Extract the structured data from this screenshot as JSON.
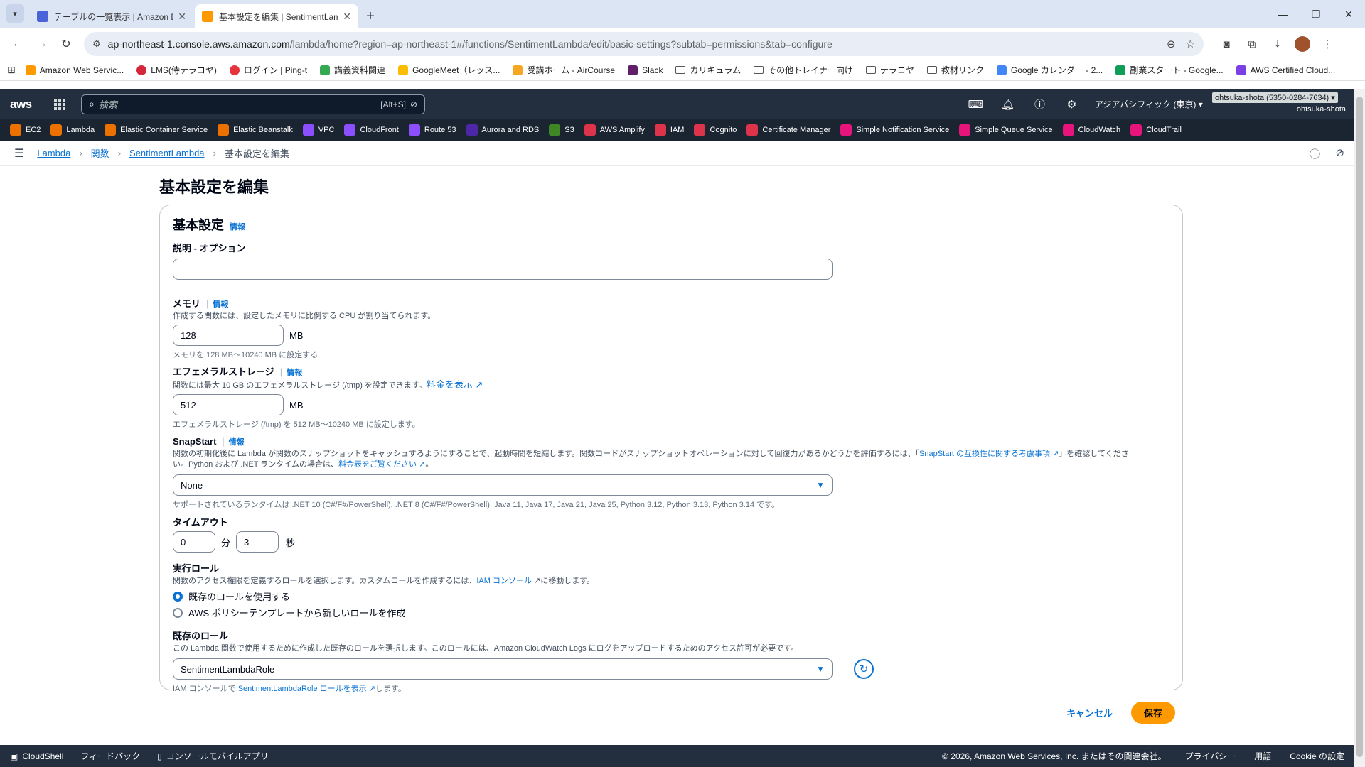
{
  "browser": {
    "tabs": [
      {
        "title": "テーブルの一覧表示 | Amazon Dy",
        "active": false,
        "color": "#4a63d9"
      },
      {
        "title": "基本設定を編集 | SentimentLam",
        "active": true,
        "color": "#ff9900"
      }
    ],
    "url_host": "ap-northeast-1.console.aws.amazon.com",
    "url_path": "/lambda/home?region=ap-northeast-1#/functions/SentimentLambda/edit/basic-settings?subtab=permissions&tab=configure",
    "bookmarks": [
      {
        "label": "Amazon Web Servic...",
        "color": "#ff9900"
      },
      {
        "label": "LMS(侍テラコヤ)",
        "color": "#d6263b"
      },
      {
        "label": "ログイン | Ping-t",
        "color": "#e6343d"
      },
      {
        "label": "講義資料関連",
        "color": "#34a853"
      },
      {
        "label": "GoogleMeet（レッス...",
        "color": "#fbbc05"
      },
      {
        "label": "受講ホーム - AirCourse",
        "color": "#f5a623"
      },
      {
        "label": "Slack",
        "color": "#611f69"
      },
      {
        "label": "カリキュラム",
        "folder": true
      },
      {
        "label": "その他トレイナー向け",
        "folder": true
      },
      {
        "label": "テラコヤ",
        "folder": true
      },
      {
        "label": "教材リンク",
        "folder": true
      },
      {
        "label": "Google カレンダー - 2...",
        "color": "#4285f4"
      },
      {
        "label": "副業スタート - Google...",
        "color": "#0f9d58"
      },
      {
        "label": "AWS Certified Cloud...",
        "color": "#7b3fe4"
      }
    ]
  },
  "aws": {
    "logo": "aws",
    "search_placeholder": "検索",
    "search_shortcut": "[Alt+S]",
    "region": "アジアパシフィック (東京) ▾",
    "account": "ohtsuka-shota (5350-0284-7634) ▾",
    "user": "ohtsuka-shota",
    "services": [
      {
        "label": "EC2",
        "color": "#ed7100"
      },
      {
        "label": "Lambda",
        "color": "#ed7100"
      },
      {
        "label": "Elastic Container Service",
        "color": "#ed7100"
      },
      {
        "label": "Elastic Beanstalk",
        "color": "#ed7100"
      },
      {
        "label": "VPC",
        "color": "#8c4fff"
      },
      {
        "label": "CloudFront",
        "color": "#8c4fff"
      },
      {
        "label": "Route 53",
        "color": "#8c4fff"
      },
      {
        "label": "Aurora and RDS",
        "color": "#4d27a8"
      },
      {
        "label": "S3",
        "color": "#3f8624"
      },
      {
        "label": "AWS Amplify",
        "color": "#dd344c"
      },
      {
        "label": "IAM",
        "color": "#dd344c"
      },
      {
        "label": "Cognito",
        "color": "#dd344c"
      },
      {
        "label": "Certificate Manager",
        "color": "#dd344c"
      },
      {
        "label": "Simple Notification Service",
        "color": "#e7157b"
      },
      {
        "label": "Simple Queue Service",
        "color": "#e7157b"
      },
      {
        "label": "CloudWatch",
        "color": "#e7157b"
      },
      {
        "label": "CloudTrail",
        "color": "#e7157b"
      }
    ],
    "breadcrumbs": [
      "Lambda",
      "関数",
      "SentimentLambda"
    ],
    "breadcrumb_current": "基本設定を編集"
  },
  "page": {
    "title": "基本設定を編集",
    "panel_title": "基本設定",
    "info": "情報",
    "description_label": "説明 - オプション",
    "description_value": "",
    "memory_label": "メモリ",
    "memory_desc": "作成する関数には、設定したメモリに比例する CPU が割り当てられます。",
    "memory_value": "128",
    "memory_unit": "MB",
    "memory_hint": "メモリを 128 MB～10240 MB に設定する",
    "ephemeral_label": "エフェメラルストレージ",
    "ephemeral_desc": "関数には最大 10 GB のエフェメラルストレージ (/tmp) を設定できます。",
    "ephemeral_link": "料金を表示",
    "ephemeral_value": "512",
    "ephemeral_unit": "MB",
    "ephemeral_hint": "エフェメラルストレージ (/tmp) を 512 MB～10240 MB に設定します。",
    "snapstart_label": "SnapStart",
    "snapstart_desc1": "関数の初期化後に Lambda が関数のスナップショットをキャッシュするようにすることで、起動時間を短縮します。関数コードがスナップショットオペレーションに対して回復力があるかどうかを評価するには、「",
    "snapstart_link1": "SnapStart の互換性に関する考慮事項",
    "snapstart_desc2": "」を確認してください。Python および .NET ランタイムの場合は、",
    "snapstart_link2": "料金表をご覧ください",
    "snapstart_desc3": "。",
    "snapstart_value": "None",
    "snapstart_hint": "サポートされているランタイムは .NET 10 (C#/F#/PowerShell), .NET 8 (C#/F#/PowerShell), Java 11, Java 17, Java 21, Java 25, Python 3.12, Python 3.13, Python 3.14 です。",
    "timeout_label": "タイムアウト",
    "timeout_min": "0",
    "timeout_min_unit": "分",
    "timeout_sec": "3",
    "timeout_sec_unit": "秒",
    "role_label": "実行ロール",
    "role_desc1": "関数のアクセス権限を定義するロールを選択します。カスタムロールを作成するには、",
    "role_link": "IAM コンソール",
    "role_desc2": "に移動します。",
    "role_option1": "既存のロールを使用する",
    "role_option2": "AWS ポリシーテンプレートから新しいロールを作成",
    "existing_role_label": "既存のロール",
    "existing_role_desc": "この Lambda 関数で使用するために作成した既存のロールを選択します。このロールには、Amazon CloudWatch Logs にログをアップロードするためのアクセス許可が必要です。",
    "existing_role_value": "SentimentLambdaRole",
    "existing_role_hint1": "IAM コンソールで",
    "existing_role_hint_link": "SentimentLambdaRole ロールを表示",
    "existing_role_hint2": "します。",
    "cancel": "キャンセル",
    "save": "保存"
  },
  "footer": {
    "cloudshell": "CloudShell",
    "feedback": "フィードバック",
    "mobile": "コンソールモバイルアプリ",
    "copyright": "© 2026, Amazon Web Services, Inc. またはその関連会社。",
    "privacy": "プライバシー",
    "terms": "用語",
    "cookie": "Cookie の設定"
  }
}
